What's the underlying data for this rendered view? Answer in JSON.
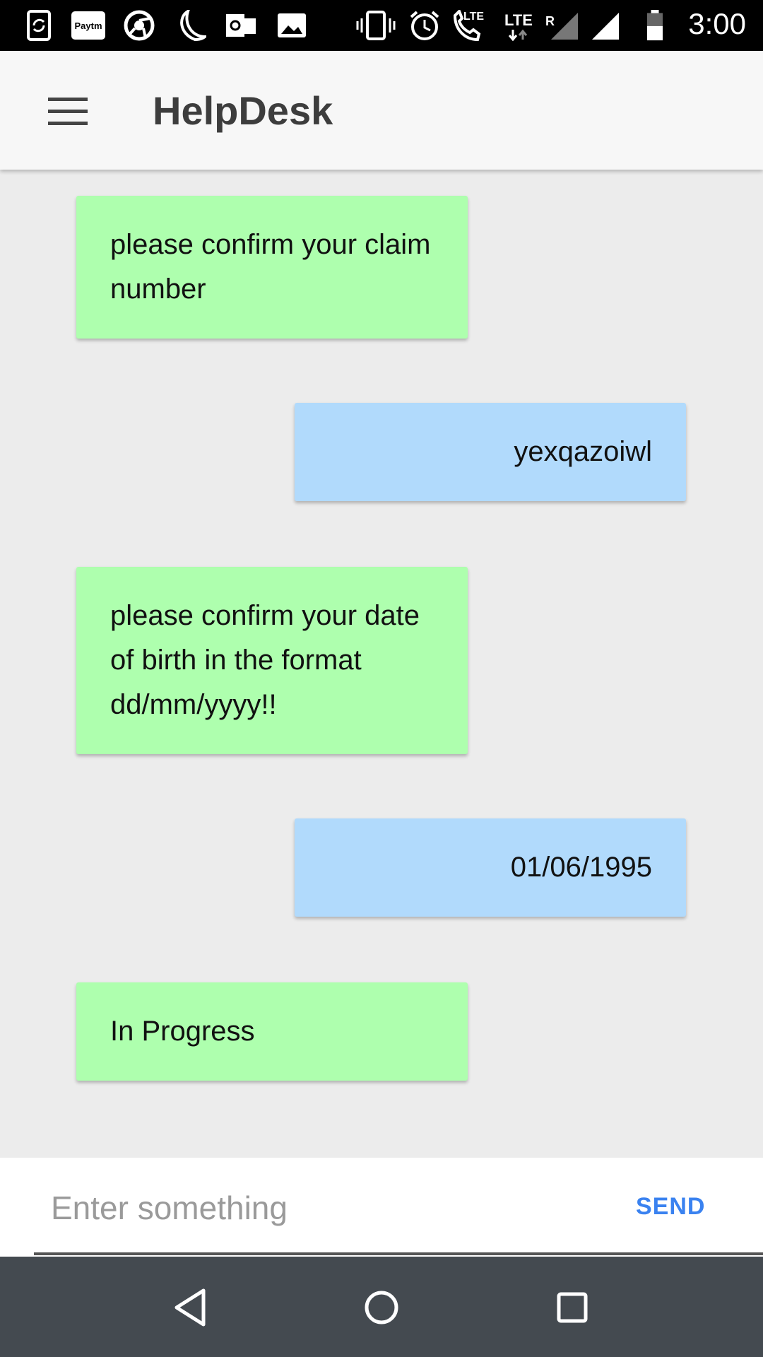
{
  "status_bar": {
    "time": "3:00",
    "icons": [
      "sync-phone-icon",
      "paytm-icon",
      "chrome-icon",
      "moon-icon",
      "outlook-icon",
      "gallery-icon",
      "vibrate-icon",
      "alarm-icon",
      "lte-call-icon",
      "lte-data-icon",
      "signal-icon",
      "signal-icon",
      "battery-icon"
    ],
    "paytm_label": "Paytm",
    "lte_label": "LTE",
    "lte_data_label": "LTE",
    "roaming_label": "R"
  },
  "app_bar": {
    "title": "HelpDesk",
    "menu_icon": "menu-icon"
  },
  "messages": [
    {
      "sender": "bot",
      "text": "please confirm your claim number"
    },
    {
      "sender": "user",
      "text": "yexqazoiwl"
    },
    {
      "sender": "bot",
      "text": "please confirm your date of birth in the format dd/mm/yyyy!!"
    },
    {
      "sender": "user",
      "text": "01/06/1995"
    },
    {
      "sender": "bot",
      "text": "In Progress"
    }
  ],
  "composer": {
    "placeholder": "Enter something",
    "value": "",
    "send_label": "SEND"
  },
  "nav_bar": {
    "icons": [
      "back-icon",
      "home-icon",
      "recents-icon"
    ]
  },
  "colors": {
    "bot_bubble": "#aeffae",
    "user_bubble": "#b1dafc",
    "send_accent": "#3a82f0",
    "chat_background": "#ececec",
    "nav_bar": "#444a50"
  }
}
